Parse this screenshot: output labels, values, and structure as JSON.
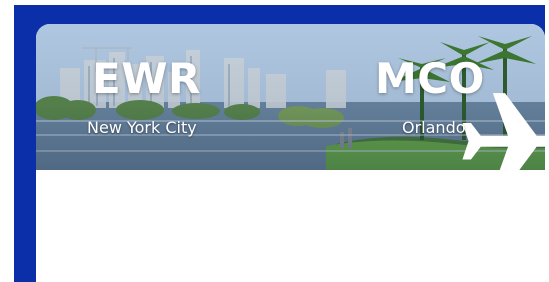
{
  "flight": {
    "origin": {
      "code": "EWR",
      "city": "New York City"
    },
    "destination": {
      "code": "MCO",
      "city": "Orlando"
    }
  },
  "icons": {
    "route": "airplane-icon"
  },
  "colors": {
    "frame": "#0b2fa8",
    "text": "#ffffff",
    "card": "#ffffff"
  }
}
